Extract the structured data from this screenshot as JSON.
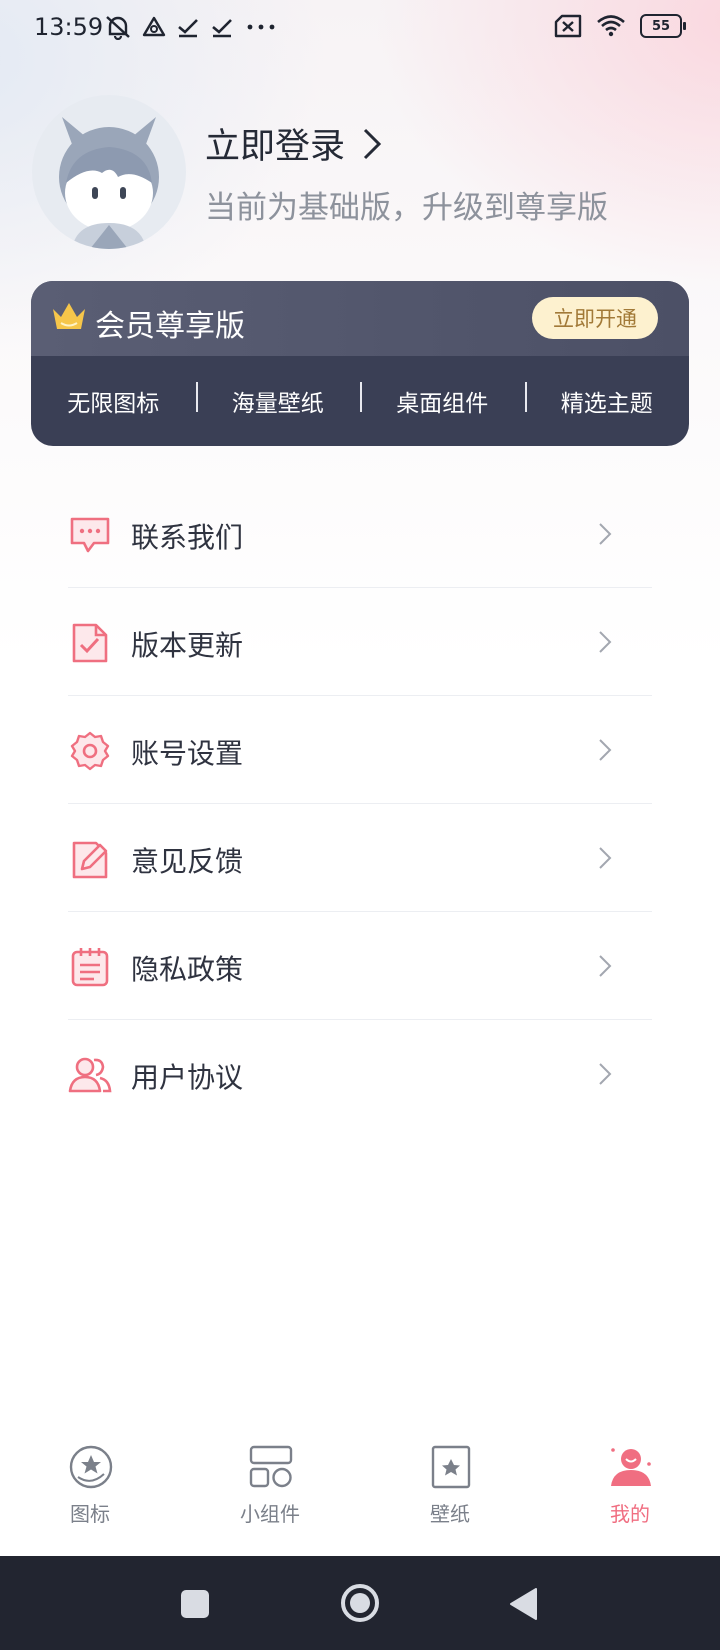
{
  "status_bar": {
    "time": "13:59",
    "battery": "55",
    "icons_left": [
      "mute-icon",
      "vpn-icon",
      "check-icon",
      "check-icon",
      "more-icon"
    ],
    "icons_right": [
      "sim-off-icon",
      "wifi-icon",
      "battery-icon"
    ]
  },
  "profile": {
    "login_text": "立即登录",
    "subtitle": "当前为基础版，升级到尊享版"
  },
  "vip": {
    "title": "会员尊享版",
    "button": "立即开通",
    "features": [
      "无限图标",
      "海量壁纸",
      "桌面组件",
      "精选主题"
    ]
  },
  "menu": [
    {
      "label": "联系我们",
      "icon": "chat-icon"
    },
    {
      "label": "版本更新",
      "icon": "update-icon"
    },
    {
      "label": "账号设置",
      "icon": "gear-icon"
    },
    {
      "label": "意见反馈",
      "icon": "edit-icon"
    },
    {
      "label": "隐私政策",
      "icon": "notepad-icon"
    },
    {
      "label": "用户协议",
      "icon": "users-icon"
    }
  ],
  "tabs": [
    {
      "label": "图标",
      "icon": "icon-tab-icon",
      "active": false
    },
    {
      "label": "小组件",
      "icon": "widget-tab-icon",
      "active": false
    },
    {
      "label": "壁纸",
      "icon": "wallpaper-tab-icon",
      "active": false
    },
    {
      "label": "我的",
      "icon": "profile-tab-icon",
      "active": true
    }
  ],
  "colors": {
    "accent": "#f06e81",
    "card_dark": "#3a3f55",
    "vip_button_bg": "#fdf1cf",
    "vip_button_text": "#a27a38"
  }
}
